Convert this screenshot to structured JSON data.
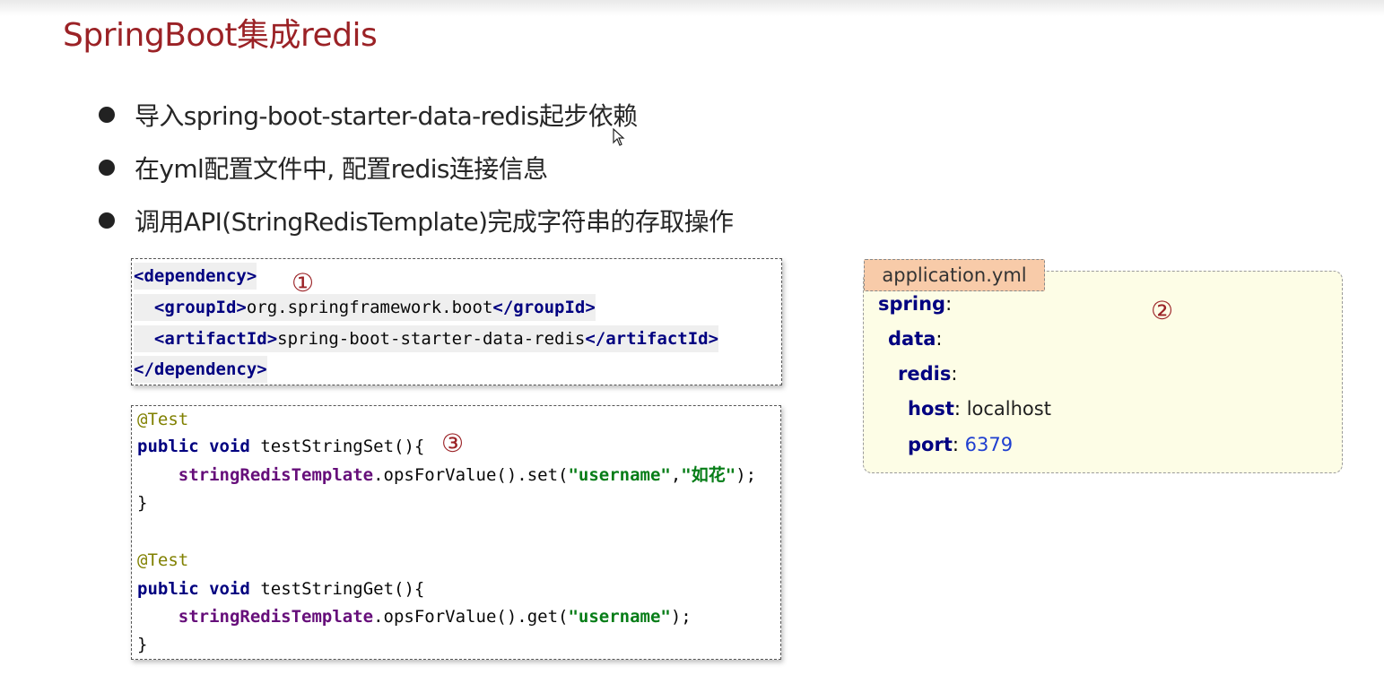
{
  "slide": {
    "title": "SpringBoot集成redis",
    "bullets": [
      "导入spring-boot-starter-data-redis起步依赖",
      "在yml配置文件中, 配置redis连接信息",
      "调用API(StringRedisTemplate)完成字符串的存取操作"
    ],
    "markers": [
      "①",
      "②",
      "③"
    ]
  },
  "dependency_code": {
    "open_tag": "<dependency>",
    "group_open": "<groupId>",
    "group_value": "org.springframework.boot",
    "group_close": "</groupId>",
    "artifact_open": "<artifactId>",
    "artifact_value": "spring-boot-starter-data-redis",
    "artifact_close": "</artifactId>",
    "close_tag": "</dependency>"
  },
  "yml": {
    "tab_label": "application.yml",
    "spring": "spring",
    "data": "data",
    "redis": "redis",
    "host_key": "host",
    "host_value": "localhost",
    "port_key": "port",
    "port_value": "6379",
    "colon": ":"
  },
  "test_code": {
    "annotation": "@Test",
    "kw_public": "public",
    "kw_void": "void",
    "method_set": "testStringSet(){",
    "method_get": "testStringGet(){",
    "field": "stringRedisTemplate",
    "call_set_a": ".opsForValue().set(",
    "str_username": "\"username\"",
    "comma": ",",
    "str_value": "\"如花\"",
    "call_end": ");",
    "call_get_a": ".opsForValue().get(",
    "close_brace": "}"
  },
  "colors": {
    "title": "#9b2226",
    "tag": "#000080",
    "string": "#067d17",
    "field": "#660e7a",
    "annotation": "#808000",
    "yml_background": "#fdfde6",
    "yml_tab": "#f8cba9"
  }
}
